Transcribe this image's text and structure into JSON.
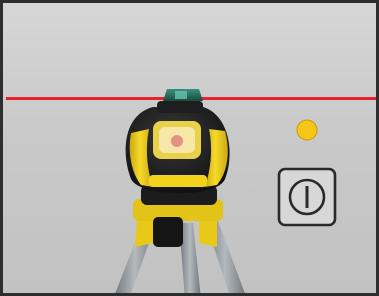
{
  "scene": {
    "subject": "rotating-laser-level-on-tripod",
    "colors": {
      "background": "#c9c9c9",
      "frame": "#2e2e2e",
      "laser_line": "#e8222a",
      "instrument_yellow": "#f2d21a",
      "instrument_black": "#1c1c1c",
      "indicator_led": "#f5c518",
      "power_icon_stroke": "#2a2a2a",
      "tripod_legs": "#8f969b"
    },
    "icons": [
      "power-button-icon",
      "indicator-light-icon"
    ]
  }
}
